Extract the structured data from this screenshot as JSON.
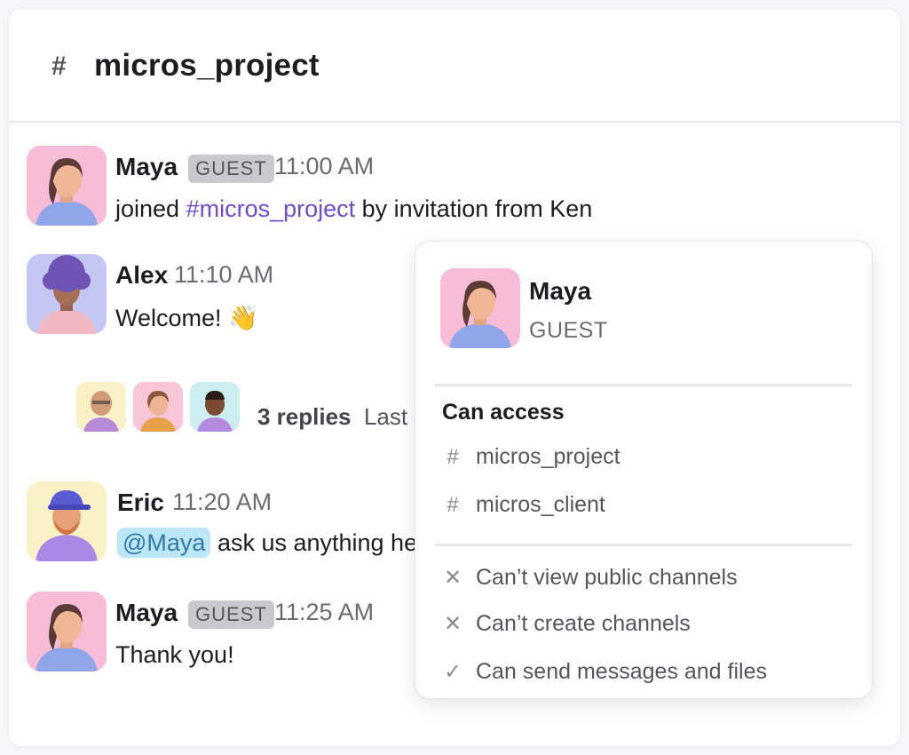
{
  "channel": {
    "hash": "#",
    "name": "micros_project"
  },
  "messages": [
    {
      "name": "Maya",
      "badge": "GUEST",
      "time": "11:00 AM",
      "text_pre": "joined ",
      "text_link": "#micros_project",
      "text_post": " by invitation from Ken"
    },
    {
      "name": "Alex",
      "time": "11:10 AM",
      "text": "Welcome! 👋"
    },
    {
      "name": "Eric",
      "time": "11:20 AM",
      "mention": "@Maya",
      "text": " ask us anything he"
    },
    {
      "name": "Maya",
      "badge": "GUEST",
      "time": "11:25 AM",
      "text": "Thank you!"
    }
  ],
  "thread": {
    "count": "3 replies",
    "last": "Last"
  },
  "popover": {
    "name": "Maya",
    "role": "GUEST",
    "section_title": "Can access",
    "channels": [
      "micros_project",
      "micros_client"
    ],
    "permissions": [
      {
        "icon": "x-icon",
        "label": "Can’t view public channels"
      },
      {
        "icon": "x-icon",
        "label": "Can’t create channels"
      },
      {
        "icon": "check-icon",
        "label": "Can send messages and files"
      }
    ]
  },
  "colors": {
    "link": "#6d4bd3",
    "mention_bg": "#bde6f6",
    "badge_bg": "#c9c9cd"
  }
}
